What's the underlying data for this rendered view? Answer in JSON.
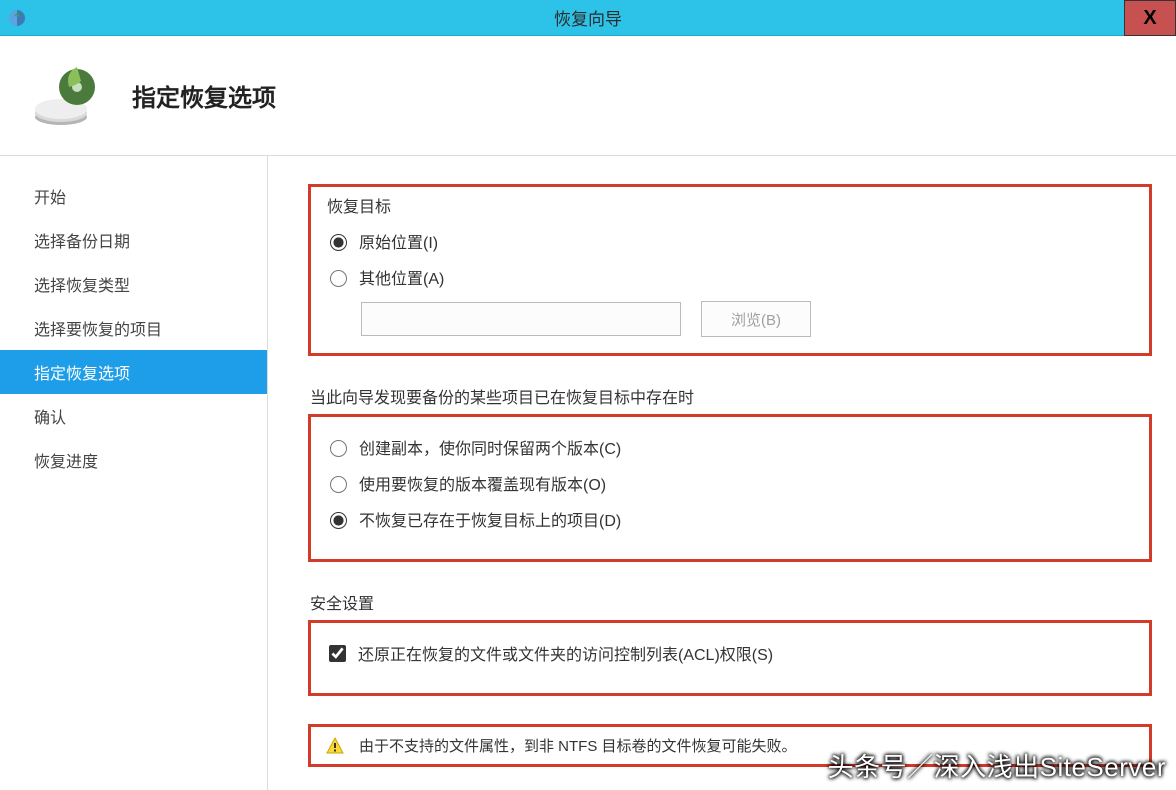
{
  "window": {
    "title": "恢复向导",
    "close_symbol": "X"
  },
  "header": {
    "title": "指定恢复选项"
  },
  "sidebar": {
    "steps": [
      {
        "label": "开始",
        "current": false
      },
      {
        "label": "选择备份日期",
        "current": false
      },
      {
        "label": "选择恢复类型",
        "current": false
      },
      {
        "label": "选择要恢复的项目",
        "current": false
      },
      {
        "label": "指定恢复选项",
        "current": true
      },
      {
        "label": "确认",
        "current": false
      },
      {
        "label": "恢复进度",
        "current": false
      }
    ]
  },
  "destination": {
    "legend": "恢复目标",
    "options": {
      "original": {
        "label": "原始位置(I)",
        "checked": true
      },
      "alternate": {
        "label": "其他位置(A)",
        "checked": false
      }
    },
    "path_value": "",
    "browse_label": "浏览(B)"
  },
  "conflict": {
    "legend": "当此向导发现要备份的某些项目已在恢复目标中存在时",
    "options": {
      "copy": {
        "label": "创建副本，使你同时保留两个版本(C)",
        "checked": false
      },
      "overwrite": {
        "label": "使用要恢复的版本覆盖现有版本(O)",
        "checked": false
      },
      "skip": {
        "label": "不恢复已存在于恢复目标上的项目(D)",
        "checked": true
      }
    }
  },
  "security": {
    "legend": "安全设置",
    "acl": {
      "label": "还原正在恢复的文件或文件夹的访问控制列表(ACL)权限(S)",
      "checked": true
    }
  },
  "warning": {
    "text": "由于不支持的文件属性，到非 NTFS 目标卷的文件恢复可能失败。"
  },
  "watermark": "头条号／深入浅出SiteServer"
}
